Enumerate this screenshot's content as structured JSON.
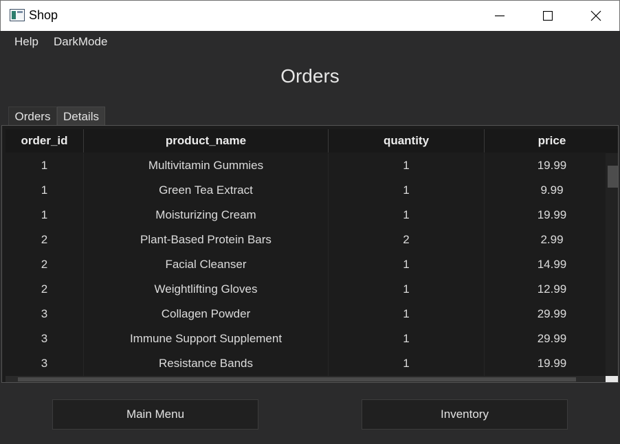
{
  "window": {
    "title": "Shop",
    "app_icon": "window-icon",
    "controls": [
      "minimize-icon",
      "maximize-icon",
      "close-icon"
    ]
  },
  "menu": {
    "help": "Help",
    "darkmode": "DarkMode"
  },
  "page": {
    "title": "Orders"
  },
  "tabs": [
    {
      "label": "Orders",
      "selected": false
    },
    {
      "label": "Details",
      "selected": true
    }
  ],
  "table": {
    "columns": [
      "order_id",
      "product_name",
      "quantity",
      "price"
    ],
    "rows": [
      [
        "1",
        "Multivitamin Gummies",
        "1",
        "19.99"
      ],
      [
        "1",
        "Green Tea Extract",
        "1",
        "9.99"
      ],
      [
        "1",
        "Moisturizing Cream",
        "1",
        "19.99"
      ],
      [
        "2",
        "Plant-Based Protein Bars",
        "2",
        "2.99"
      ],
      [
        "2",
        "Facial Cleanser",
        "1",
        "14.99"
      ],
      [
        "2",
        "Weightlifting Gloves",
        "1",
        "12.99"
      ],
      [
        "3",
        "Collagen Powder",
        "1",
        "29.99"
      ],
      [
        "3",
        "Immune Support Supplement",
        "1",
        "29.99"
      ],
      [
        "3",
        "Resistance Bands",
        "1",
        "19.99"
      ]
    ]
  },
  "buttons": {
    "main_menu": "Main Menu",
    "inventory": "Inventory"
  },
  "colors": {
    "background": "#2b2b2c",
    "table_background": "#1c1c1c",
    "text": "#e3e3e3"
  }
}
